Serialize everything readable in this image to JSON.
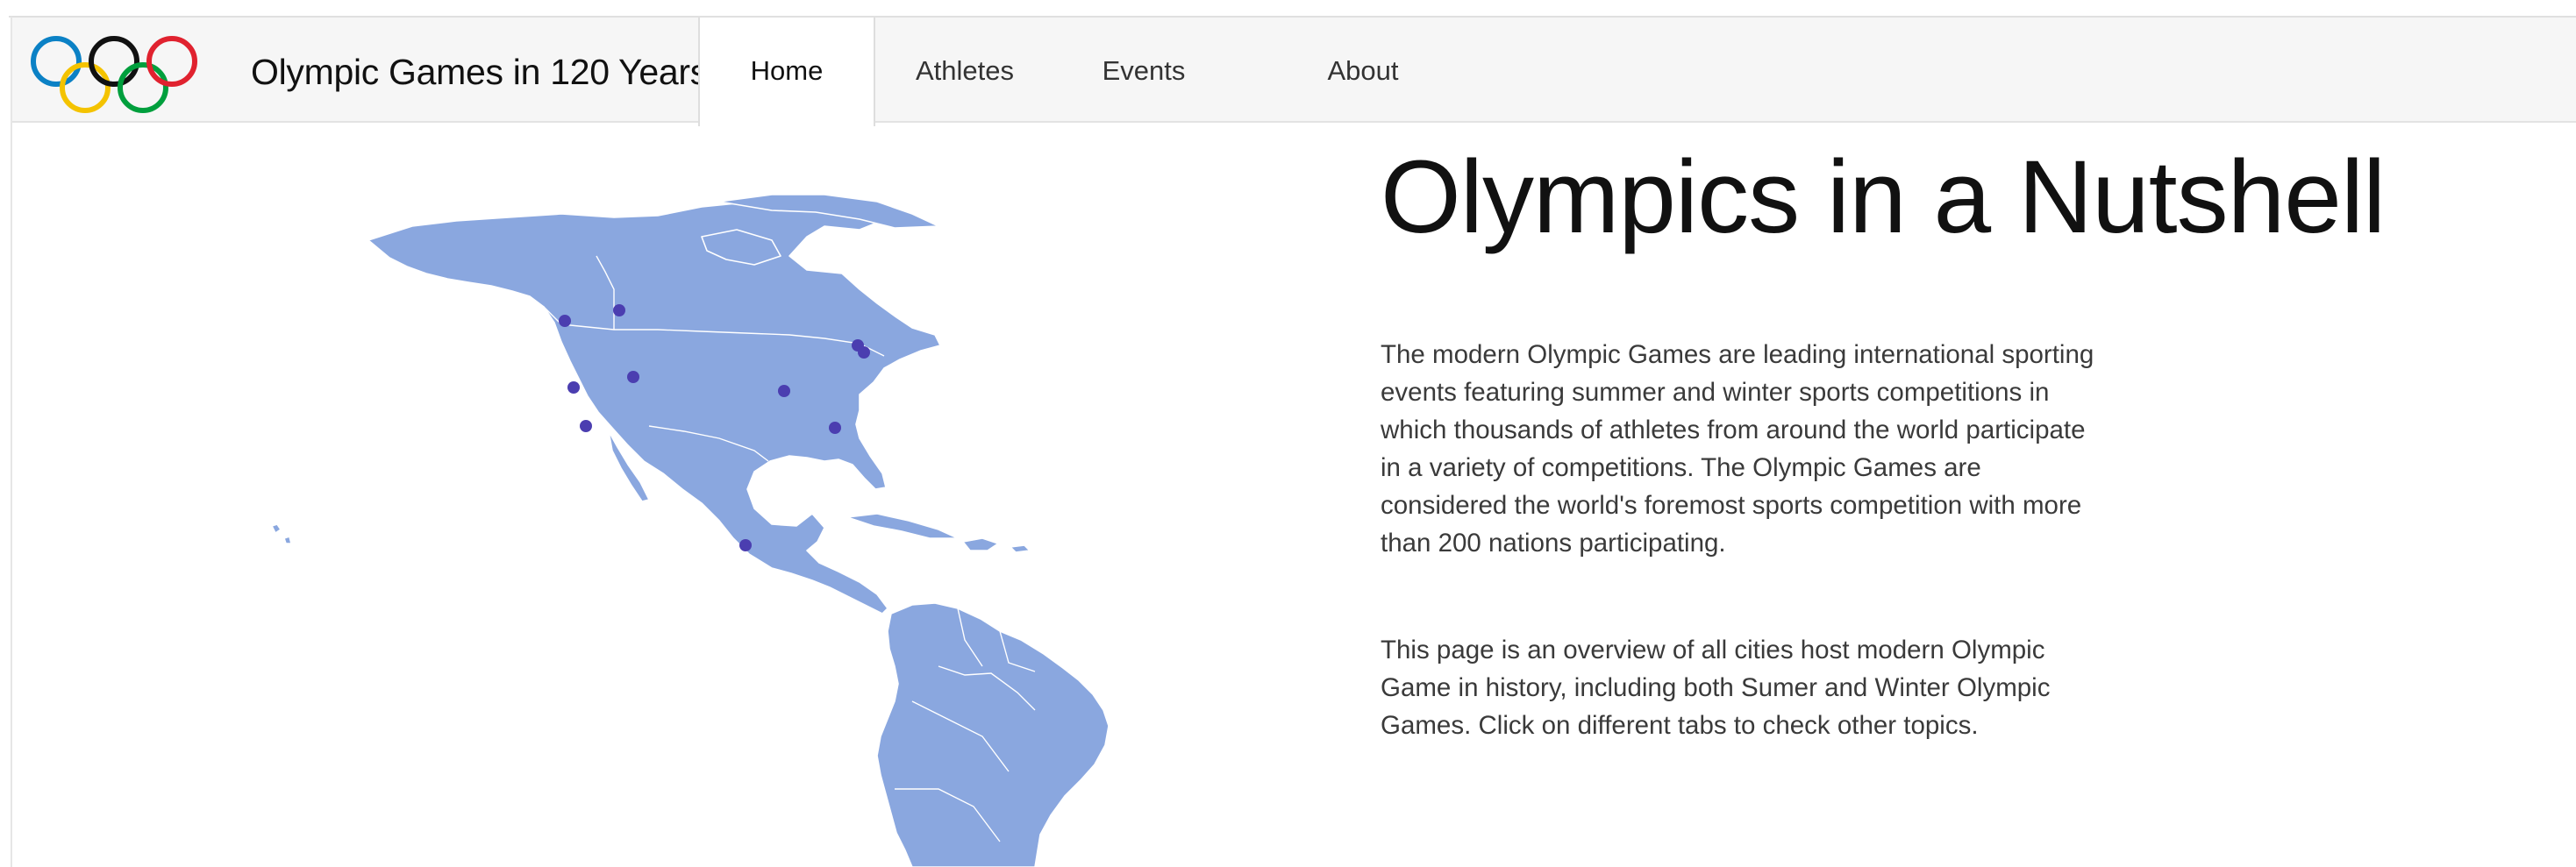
{
  "app": {
    "brand_title": "Olympic Games in 120 Years",
    "logo_icon": "olympic-rings-icon"
  },
  "nav": {
    "tabs": [
      {
        "label": "Home",
        "active": true
      },
      {
        "label": "Athletes",
        "active": false
      },
      {
        "label": "Events",
        "active": false
      },
      {
        "label": "About",
        "active": false
      }
    ]
  },
  "main": {
    "title": "Olympics in a Nutshell",
    "paragraph_1": "The modern Olympic Games are leading international sporting events featuring summer and winter sports competitions in which thousands of athletes from around the world participate in a variety of competitions. The Olympic Games are considered the world's foremost sports competition with more than 200 nations participating.",
    "paragraph_2": "This page is an overview of all cities host modern Olympic Game in history, including both Sumer and Winter Olympic Games. Click on different tabs to check other topics."
  },
  "map": {
    "land_color": "#8aa7df",
    "marker_color": "#4b3eb0",
    "border_color": "#ffffff"
  },
  "colors": {
    "ring_blue": "#0b81c5",
    "ring_black": "#111111",
    "ring_red": "#e0222f",
    "ring_yellow": "#f4c300",
    "ring_green": "#009f3d",
    "navbar_bg": "#f6f6f6"
  }
}
